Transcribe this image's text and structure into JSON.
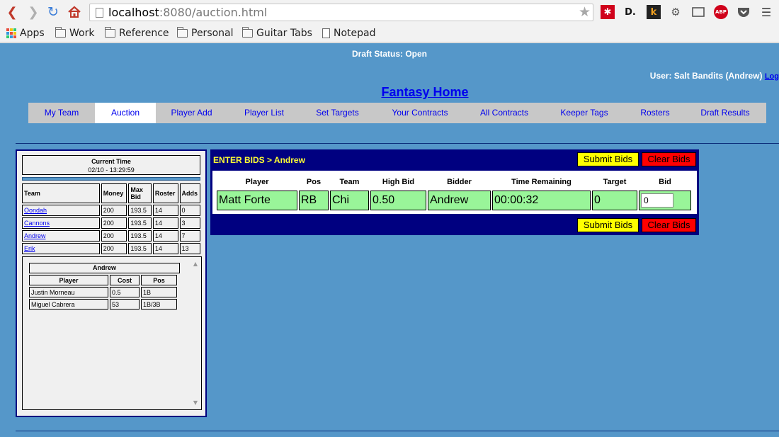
{
  "browser": {
    "url_host": "localhost",
    "url_rest": ":8080/auction.html",
    "bookmarks": [
      "Apps",
      "Work",
      "Reference",
      "Personal",
      "Guitar Tabs",
      "Notepad"
    ],
    "ext_labels": {
      "d": "D.",
      "k": "k",
      "abp": "ABP"
    }
  },
  "page": {
    "draft_status": "Draft Status: Open",
    "user_label": "User: Salt Bandits (Andrew)",
    "logout_text": "Log",
    "home_title": "Fantasy Home",
    "nav": [
      "My Team",
      "Auction",
      "Player Add",
      "Player List",
      "Set Targets",
      "Your Contracts",
      "All Contracts",
      "Keeper Tags",
      "Rosters",
      "Draft Results"
    ],
    "active_nav": "Auction"
  },
  "left_panel": {
    "time_label": "Current Time",
    "time_value": "02/10 - 13:29:59",
    "team_headers": [
      "Team",
      "Money",
      "Max Bid",
      "Roster",
      "Adds"
    ],
    "teams": [
      {
        "team": "Oondah",
        "money": "200",
        "max_bid": "193.5",
        "roster": "14",
        "adds": "0"
      },
      {
        "team": "Cannons",
        "money": "200",
        "max_bid": "193.5",
        "roster": "14",
        "adds": "3"
      },
      {
        "team": "Andrew",
        "money": "200",
        "max_bid": "193.5",
        "roster": "14",
        "adds": "7"
      },
      {
        "team": "Erik",
        "money": "200",
        "max_bid": "193.5",
        "roster": "14",
        "adds": "13"
      }
    ],
    "roster_title": "Andrew",
    "roster_headers": [
      "Player",
      "Cost",
      "Pos"
    ],
    "roster": [
      {
        "player": "Justin Morneau",
        "cost": "0.5",
        "pos": "1B"
      },
      {
        "player": "Miguel Cabrera",
        "cost": "53",
        "pos": "1B/3B"
      }
    ]
  },
  "bids": {
    "header": "ENTER BIDS > Andrew",
    "submit_label": "Submit Bids",
    "clear_label": "Clear Bids",
    "columns": [
      "Player",
      "Pos",
      "Team",
      "High Bid",
      "Bidder",
      "Time Remaining",
      "Target",
      "Bid"
    ],
    "row": {
      "player": "Matt Forte",
      "pos": "RB",
      "team": "Chi",
      "high_bid": "0.50",
      "bidder": "Andrew",
      "time_remaining": "00:00:32",
      "target": "0",
      "bid": "0"
    }
  },
  "colors": {
    "page_bg": "#5597c9",
    "panel_navy": "#000080",
    "cell_green": "#99f599",
    "submit_yellow": "#ffff00",
    "clear_red": "#ff0000",
    "link_blue": "#0000ee",
    "header_yellow": "#ffff33"
  }
}
